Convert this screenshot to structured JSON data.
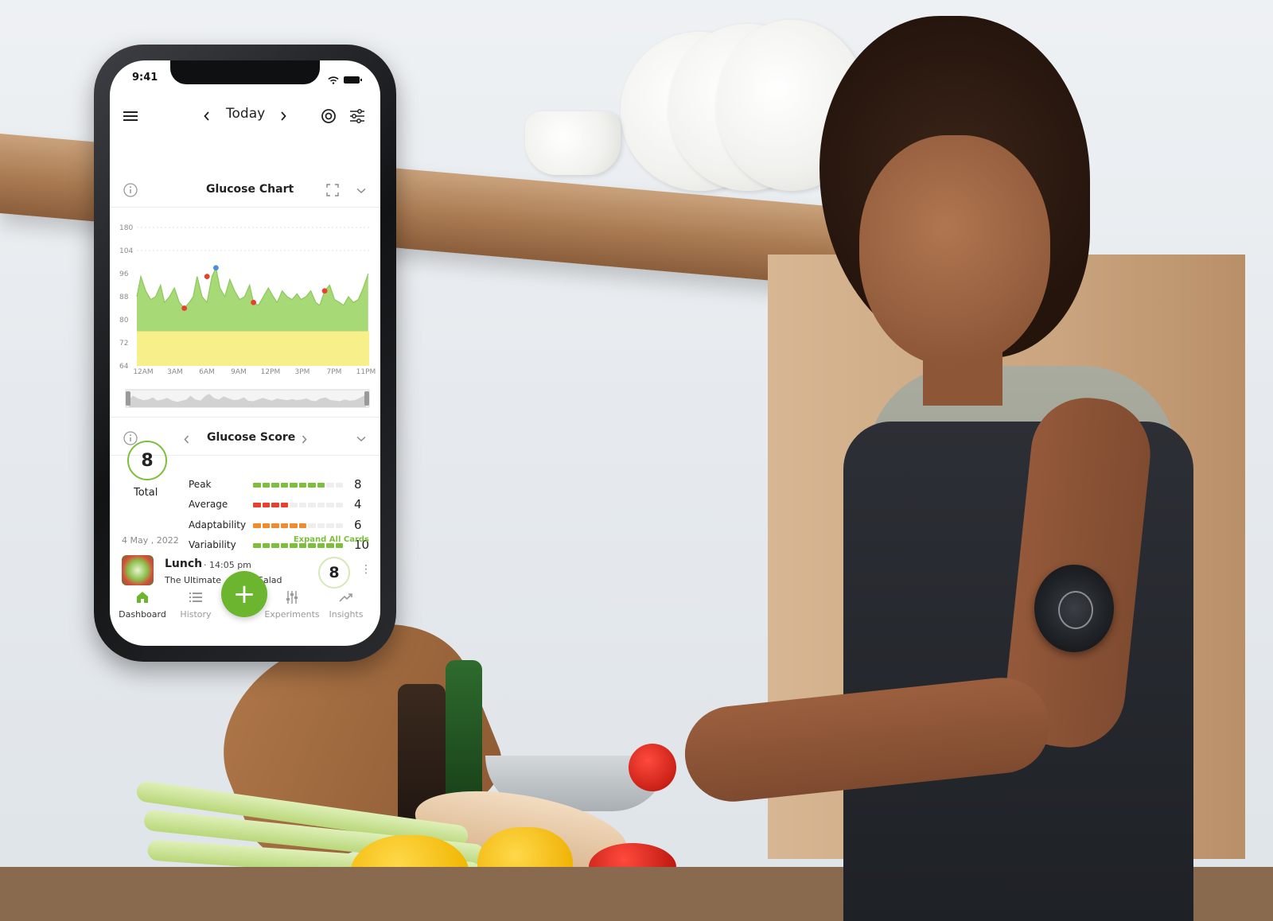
{
  "status_bar": {
    "time": "9:41"
  },
  "header": {
    "title": "Today",
    "icons": [
      "menu-icon",
      "chevron-left-icon",
      "chevron-right-icon",
      "target-icon",
      "filters-icon"
    ]
  },
  "glucose_chart_card": {
    "title": "Glucose Chart",
    "icons": [
      "info-icon",
      "expand-icon",
      "chevron-down-icon"
    ]
  },
  "chart_data": {
    "type": "area",
    "title": "",
    "xlabel": "",
    "ylabel": "",
    "y_ticks": [
      "180",
      "104",
      "96",
      "88",
      "80",
      "72",
      "64"
    ],
    "x_ticks": [
      "12AM",
      "3AM",
      "6AM",
      "9AM",
      "12PM",
      "3PM",
      "7PM",
      "11PM"
    ],
    "target_band": {
      "from": 64,
      "to": 76,
      "color": "#f7ef8a"
    },
    "series": [
      {
        "color": "#a7d977",
        "x": [
          0.0,
          0.4,
          0.9,
          1.4,
          1.9,
          2.4,
          2.8,
          3.3,
          3.8,
          4.3,
          4.8,
          5.3,
          5.7,
          6.1,
          6.6,
          7.1,
          7.6,
          8.0,
          8.4,
          8.9,
          9.4,
          9.9,
          10.4,
          10.9,
          11.4,
          11.8,
          12.3,
          12.8,
          13.3,
          13.8,
          14.2,
          14.7,
          15.2,
          15.7,
          16.2,
          16.6,
          17.1,
          17.6,
          18.1,
          18.5,
          19.0,
          19.5,
          20.0,
          20.5,
          20.9,
          21.4,
          21.9,
          22.4,
          22.9,
          23.4
        ],
        "y": [
          88,
          95,
          90,
          87,
          88,
          92,
          86,
          88,
          91,
          86,
          84,
          86,
          88,
          95,
          88,
          86,
          95,
          98,
          91,
          88,
          94,
          90,
          87,
          88,
          92,
          86,
          85,
          88,
          91,
          88,
          86,
          90,
          88,
          87,
          89,
          87,
          88,
          90,
          86,
          85,
          90,
          92,
          87,
          86,
          85,
          88,
          86,
          87,
          91,
          96
        ]
      }
    ],
    "highlight_points": [
      {
        "x": 4.8,
        "y": 84,
        "color": "#e8402d"
      },
      {
        "x": 7.1,
        "y": 95,
        "color": "#e8402d"
      },
      {
        "x": 8.0,
        "y": 98,
        "color": "#4a8fe0"
      },
      {
        "x": 11.8,
        "y": 86,
        "color": "#e8402d"
      },
      {
        "x": 19.0,
        "y": 90,
        "color": "#e8402d"
      }
    ],
    "grid": false,
    "ylim": [
      64,
      110
    ]
  },
  "glucose_score_card": {
    "title": "Glucose Score",
    "total_value": "8",
    "total_label": "Total",
    "metrics": [
      {
        "label": "Peak",
        "value": "8",
        "filled": 8,
        "color": "#7cbf3b"
      },
      {
        "label": "Average",
        "value": "4",
        "filled": 4,
        "color": "#e8402d"
      },
      {
        "label": "Adaptability",
        "value": "6",
        "filled": 6,
        "color": "#f28a2e"
      },
      {
        "label": "Variability",
        "value": "10",
        "filled": 10,
        "color": "#7cbf3b"
      }
    ],
    "segments_total": 10
  },
  "feed": {
    "date": "4 May , 2022",
    "expand_label": "Expand All Cards",
    "entry": {
      "name": "Lunch",
      "time": "· 14:05 pm",
      "description": "The Ultimate",
      "description_tail": "Salad",
      "score": "8"
    }
  },
  "bottom_nav": {
    "fab_label": "+",
    "items": [
      {
        "label": "Dashboard",
        "icon": "home-icon",
        "active": true
      },
      {
        "label": "History",
        "icon": "list-icon",
        "active": false
      },
      {
        "label": "Experiments",
        "icon": "sliders-icon",
        "active": false
      },
      {
        "label": "Insights",
        "icon": "trend-icon",
        "active": false
      }
    ]
  },
  "colors": {
    "accent": "#6cb52f",
    "chart_fill": "#a7d977",
    "target_band": "#f7ef8a"
  }
}
